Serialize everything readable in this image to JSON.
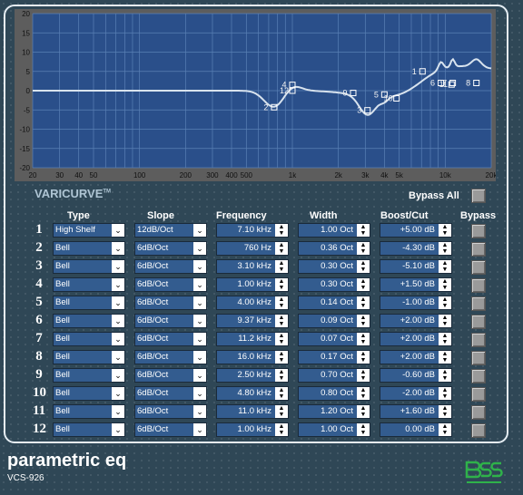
{
  "graph": {
    "x_ticks": [
      "20",
      "30",
      "40",
      "50",
      "100",
      "200",
      "300",
      "400",
      "500",
      "1k",
      "2k",
      "3k",
      "4k",
      "5k",
      "10k",
      "20k"
    ],
    "y_ticks": [
      "20",
      "15",
      "10",
      "5",
      "0",
      "-5",
      "-10",
      "-15",
      "-20"
    ],
    "points": [
      {
        "label": "1",
        "freq": 7100,
        "gain": 5.0
      },
      {
        "label": "2",
        "freq": 760,
        "gain": -4.3
      },
      {
        "label": "3",
        "freq": 3100,
        "gain": -5.1
      },
      {
        "label": "4",
        "freq": 1000,
        "gain": 1.5
      },
      {
        "label": "5",
        "freq": 4000,
        "gain": -1.0
      },
      {
        "label": "6",
        "freq": 9370,
        "gain": 2.0
      },
      {
        "label": "7",
        "freq": 11200,
        "gain": 2.0
      },
      {
        "label": "8",
        "freq": 16000,
        "gain": 2.0
      },
      {
        "label": "9",
        "freq": 2500,
        "gain": -0.6
      },
      {
        "label": "10",
        "freq": 4800,
        "gain": -2.0
      },
      {
        "label": "11",
        "freq": 11000,
        "gain": 1.6
      },
      {
        "label": "12",
        "freq": 1000,
        "gain": 0.0
      }
    ],
    "colors": {
      "plot_bg": "#2a4f8a",
      "grid": "#5a80b5",
      "curve": "#d8e3ee",
      "frame": "#5d5d5d"
    }
  },
  "logo": {
    "text": "VARICURVE",
    "tm": "TM"
  },
  "bypass_all_label": "Bypass All",
  "headers": {
    "type": "Type",
    "slope": "Slope",
    "frequency": "Frequency",
    "width": "Width",
    "boost": "Boost/Cut",
    "bypass": "Bypass"
  },
  "bands": [
    {
      "num": "1",
      "type": "High Shelf",
      "slope": "12dB/Oct",
      "freq": "7.10 kHz",
      "width": "1.00 Oct",
      "boost": "+5.00 dB"
    },
    {
      "num": "2",
      "type": "Bell",
      "slope": "6dB/Oct",
      "freq": "760 Hz",
      "width": "0.36 Oct",
      "boost": "-4.30 dB"
    },
    {
      "num": "3",
      "type": "Bell",
      "slope": "6dB/Oct",
      "freq": "3.10 kHz",
      "width": "0.30 Oct",
      "boost": "-5.10 dB"
    },
    {
      "num": "4",
      "type": "Bell",
      "slope": "6dB/Oct",
      "freq": "1.00 kHz",
      "width": "0.30 Oct",
      "boost": "+1.50 dB"
    },
    {
      "num": "5",
      "type": "Bell",
      "slope": "6dB/Oct",
      "freq": "4.00 kHz",
      "width": "0.14 Oct",
      "boost": "-1.00 dB"
    },
    {
      "num": "6",
      "type": "Bell",
      "slope": "6dB/Oct",
      "freq": "9.37 kHz",
      "width": "0.09 Oct",
      "boost": "+2.00 dB"
    },
    {
      "num": "7",
      "type": "Bell",
      "slope": "6dB/Oct",
      "freq": "11.2 kHz",
      "width": "0.07 Oct",
      "boost": "+2.00 dB"
    },
    {
      "num": "8",
      "type": "Bell",
      "slope": "6dB/Oct",
      "freq": "16.0 kHz",
      "width": "0.17 Oct",
      "boost": "+2.00 dB"
    },
    {
      "num": "9",
      "type": "Bell",
      "slope": "6dB/Oct",
      "freq": "2.50 kHz",
      "width": "0.70 Oct",
      "boost": "-0.60 dB"
    },
    {
      "num": "10",
      "type": "Bell",
      "slope": "6dB/Oct",
      "freq": "4.80 kHz",
      "width": "0.80 Oct",
      "boost": "-2.00 dB"
    },
    {
      "num": "11",
      "type": "Bell",
      "slope": "6dB/Oct",
      "freq": "11.0 kHz",
      "width": "1.20 Oct",
      "boost": "+1.60 dB"
    },
    {
      "num": "12",
      "type": "Bell",
      "slope": "6dB/Oct",
      "freq": "1.00 kHz",
      "width": "1.00 Oct",
      "boost": "0.00 dB"
    }
  ],
  "footer": {
    "title": "parametric eq",
    "model": "VCS-926"
  },
  "icons": {
    "dropdown": "chevron-down-icon",
    "spinner": "up-down-arrows-icon",
    "brand": "bss-logo-icon"
  }
}
